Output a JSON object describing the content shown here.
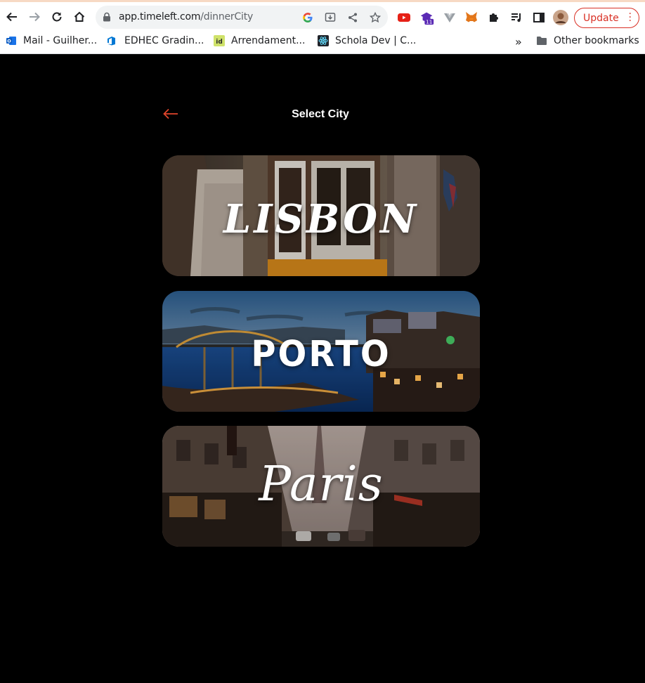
{
  "browser": {
    "url_host": "app.timeleft.com",
    "url_path": "/dinnerCity",
    "update_label": "Update",
    "ext_badge": "11"
  },
  "bookmarks": [
    {
      "label": "Mail - Guilher..."
    },
    {
      "label": "EDHEC Gradin..."
    },
    {
      "label": "Arrendament..."
    },
    {
      "label": "Schola Dev | C..."
    }
  ],
  "bookmarks_overflow": "»",
  "other_bookmarks": "Other bookmarks",
  "page": {
    "title": "Select City",
    "accent": "#e0452b"
  },
  "cities": [
    {
      "name": "LISBON"
    },
    {
      "name": "PORTO"
    },
    {
      "name": "Paris"
    }
  ]
}
